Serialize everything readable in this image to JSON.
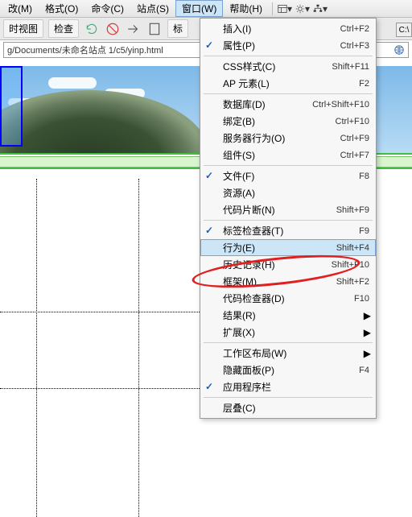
{
  "menubar": {
    "items": [
      "改(M)",
      "格式(O)",
      "命令(C)",
      "站点(S)",
      "窗口(W)",
      "帮助(H)"
    ],
    "active_index": 4
  },
  "toolbar2": {
    "btn_view": "时视图",
    "btn_inspect": "检查",
    "btn_tag": "标"
  },
  "addrbar": {
    "path": "g/Documents/未命名站点 1/c5/yinp.html"
  },
  "filetab": {
    "label": "C:\\"
  },
  "dropdown": {
    "groups": [
      [
        {
          "label": "插入(I)",
          "shortcut": "Ctrl+F2",
          "checked": false
        },
        {
          "label": "属性(P)",
          "shortcut": "Ctrl+F3",
          "checked": true
        }
      ],
      [
        {
          "label": "CSS样式(C)",
          "shortcut": "Shift+F11",
          "checked": false
        },
        {
          "label": "AP 元素(L)",
          "shortcut": "F2",
          "checked": false
        }
      ],
      [
        {
          "label": "数据库(D)",
          "shortcut": "Ctrl+Shift+F10",
          "checked": false
        },
        {
          "label": "绑定(B)",
          "shortcut": "Ctrl+F10",
          "checked": false
        },
        {
          "label": "服务器行为(O)",
          "shortcut": "Ctrl+F9",
          "checked": false
        },
        {
          "label": "组件(S)",
          "shortcut": "Ctrl+F7",
          "checked": false
        }
      ],
      [
        {
          "label": "文件(F)",
          "shortcut": "F8",
          "checked": true
        },
        {
          "label": "资源(A)",
          "shortcut": "",
          "checked": false
        },
        {
          "label": "代码片断(N)",
          "shortcut": "Shift+F9",
          "checked": false
        }
      ],
      [
        {
          "label": "标签检查器(T)",
          "shortcut": "F9",
          "checked": true
        },
        {
          "label": "行为(E)",
          "shortcut": "Shift+F4",
          "checked": false,
          "highlight": true
        },
        {
          "label": "历史记录(H)",
          "shortcut": "Shift+F10",
          "checked": false
        },
        {
          "label": "框架(M)",
          "shortcut": "Shift+F2",
          "checked": false
        },
        {
          "label": "代码检查器(D)",
          "shortcut": "F10",
          "checked": false
        },
        {
          "label": "结果(R)",
          "shortcut": "",
          "checked": false,
          "submenu": true
        },
        {
          "label": "扩展(X)",
          "shortcut": "",
          "checked": false,
          "submenu": true
        }
      ],
      [
        {
          "label": "工作区布局(W)",
          "shortcut": "",
          "checked": false,
          "submenu": true
        },
        {
          "label": "隐藏面板(P)",
          "shortcut": "F4",
          "checked": false
        },
        {
          "label": "应用程序栏",
          "shortcut": "",
          "checked": true
        }
      ],
      [
        {
          "label": "层叠(C)",
          "shortcut": "",
          "checked": false
        }
      ]
    ]
  }
}
